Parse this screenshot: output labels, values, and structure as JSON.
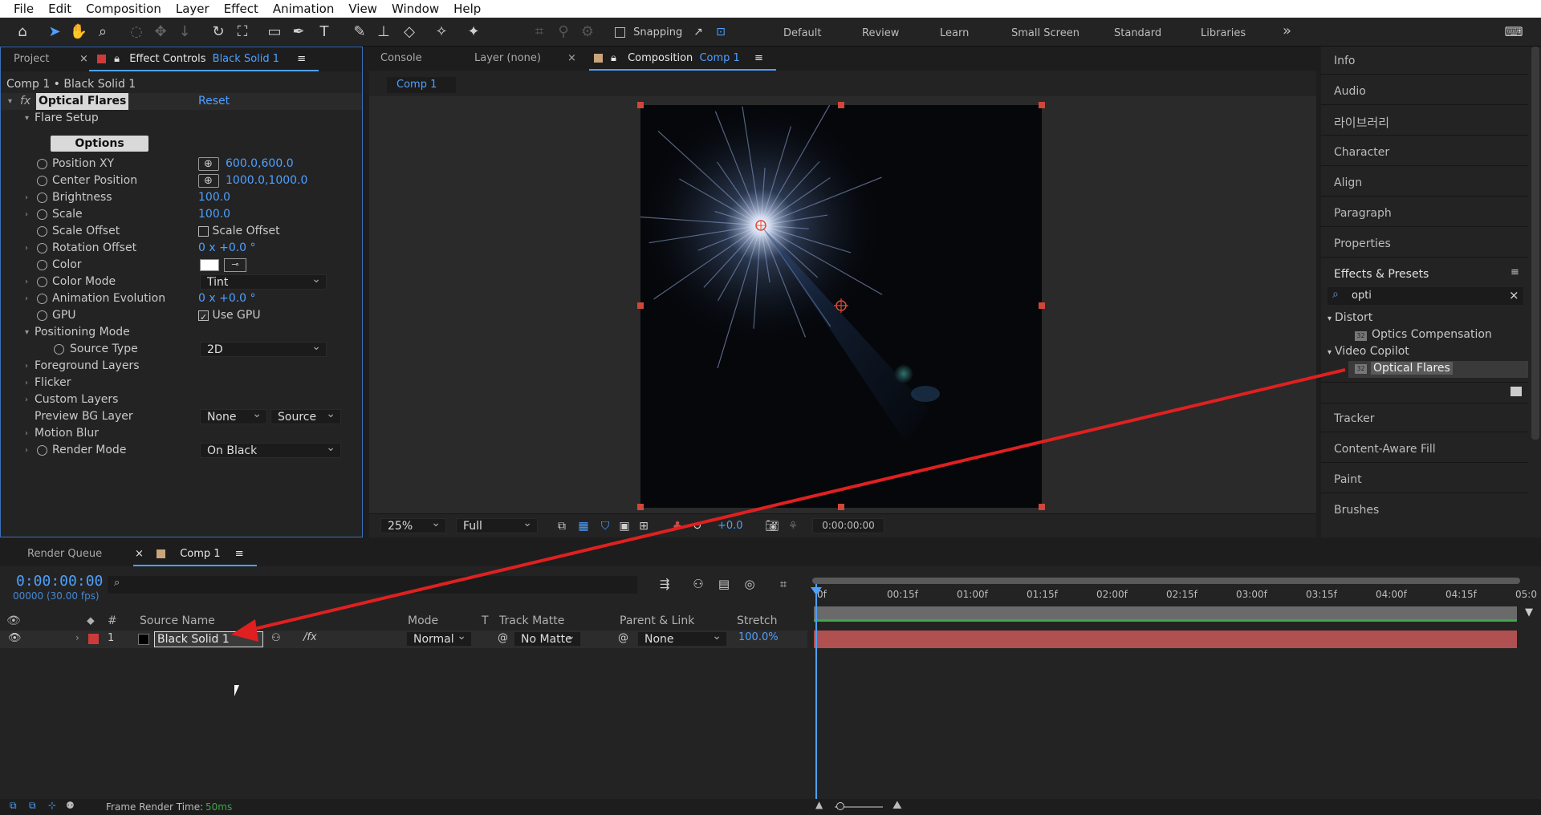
{
  "menu": [
    "File",
    "Edit",
    "Composition",
    "Layer",
    "Effect",
    "Animation",
    "View",
    "Window",
    "Help"
  ],
  "toolbar": {
    "snapping_label": "Snapping",
    "workspaces": [
      "Default",
      "Review",
      "Learn",
      "Small Screen",
      "Standard",
      "Libraries"
    ],
    "more_glyph": "»"
  },
  "effect_panel": {
    "tabs": {
      "project": "Project",
      "effect_controls": "Effect Controls",
      "effect_controls_target": "Black Solid 1"
    },
    "breadcrumb": "Comp 1 • Black Solid 1",
    "effect_name": "Optical Flares",
    "reset": "Reset",
    "flare_setup": "Flare Setup",
    "options_button": "Options",
    "properties": {
      "position_xy": {
        "label": "Position XY",
        "value": "600.0,600.0"
      },
      "center_position": {
        "label": "Center Position",
        "value": "1000.0,1000.0"
      },
      "brightness": {
        "label": "Brightness",
        "value": "100.0"
      },
      "scale": {
        "label": "Scale",
        "value": "100.0"
      },
      "scale_offset": {
        "label": "Scale Offset",
        "checkbox_label": "Scale Offset"
      },
      "rotation_offset": {
        "label": "Rotation Offset",
        "value": "0 x +0.0 °"
      },
      "color": {
        "label": "Color"
      },
      "color_mode": {
        "label": "Color Mode",
        "value": "Tint"
      },
      "animation_evolution": {
        "label": "Animation Evolution",
        "value": "0 x +0.0 °"
      },
      "gpu": {
        "label": "GPU",
        "checkbox_label": "Use GPU"
      },
      "positioning_mode": {
        "label": "Positioning Mode"
      },
      "source_type": {
        "label": "Source Type",
        "value": "2D"
      },
      "foreground_layers": {
        "label": "Foreground Layers"
      },
      "flicker": {
        "label": "Flicker"
      },
      "custom_layers": {
        "label": "Custom Layers"
      },
      "preview_bg_layer": {
        "label": "Preview BG Layer",
        "value1": "None",
        "value2": "Source"
      },
      "motion_blur": {
        "label": "Motion Blur"
      },
      "render_mode": {
        "label": "Render Mode",
        "value": "On Black"
      }
    }
  },
  "comp_panel": {
    "tabs": {
      "console": "Console",
      "layer": "Layer (none)",
      "composition": "Composition",
      "composition_target": "Comp 1"
    },
    "comp_chip": "Comp 1",
    "zoom": "25%",
    "resolution": "Full",
    "exposure": "+0.0",
    "timecode": "0:00:00:00"
  },
  "right_panel": {
    "items_top": [
      "Info",
      "Audio",
      "라이브러리",
      "Character",
      "Align",
      "Paragraph",
      "Properties"
    ],
    "effects_presets": "Effects & Presets",
    "search_value": "opti",
    "tree": {
      "distort": "Distort",
      "optics_compensation": "Optics Compensation",
      "video_copilot": "Video Copilot",
      "optical_flares": "Optical Flares"
    },
    "items_bottom": [
      "Tracker",
      "Content-Aware Fill",
      "Paint",
      "Brushes"
    ]
  },
  "timeline": {
    "tabs": {
      "render_queue": "Render Queue",
      "comp": "Comp 1"
    },
    "timecode": "0:00:00:00",
    "fps": "00000 (30.00 fps)",
    "columns": {
      "num": "#",
      "source_name": "Source Name",
      "mode": "Mode",
      "t": "T",
      "track_matte": "Track Matte",
      "parent": "Parent & Link",
      "stretch": "Stretch"
    },
    "layer": {
      "index": "1",
      "name": "Black Solid 1",
      "mode": "Normal",
      "track_matte": "No Matte",
      "parent": "None",
      "stretch": "100.0%"
    },
    "ruler": [
      "0f",
      "00:15f",
      "01:00f",
      "01:15f",
      "02:00f",
      "02:15f",
      "03:00f",
      "03:15f",
      "04:00f",
      "04:15f",
      "05:0"
    ],
    "frame_render_label": "Frame Render Time:",
    "frame_render_value": "50ms"
  },
  "colors": {
    "accent": "#4ea0ff",
    "layer_bar": "#b05050",
    "annotation_arrow": "#e02020"
  }
}
